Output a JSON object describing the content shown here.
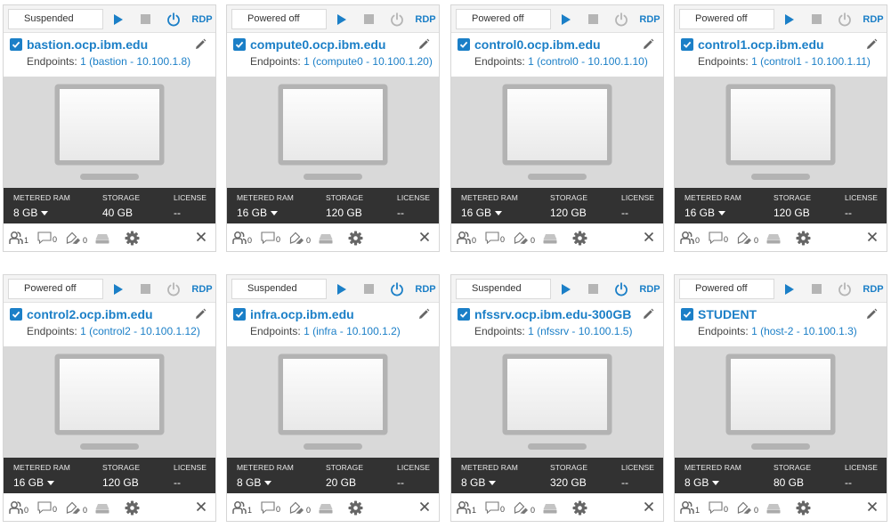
{
  "labels": {
    "rdp": "RDP",
    "endpoints_prefix": "Endpoints:",
    "metered_ram": "METERED RAM",
    "storage": "STORAGE",
    "license": "LICENSE"
  },
  "colors": {
    "accent": "#1b7fc7",
    "stats_bg": "#323232",
    "preview_bg": "#d9d9d9"
  },
  "icons": [
    "play-icon",
    "stop-icon",
    "power-icon",
    "checkbox-icon",
    "pencil-icon",
    "monitor-icon",
    "users-icon",
    "comment-icon",
    "tag-icon",
    "disk-icon",
    "gear-icon",
    "close-icon"
  ],
  "vms": [
    {
      "status": "Suspended",
      "power_on": true,
      "name": "bastion.ocp.ibm.edu",
      "endpoint": "1 (bastion - 10.100.1.8)",
      "ram": "8 GB",
      "storage": "40 GB",
      "license": "--",
      "users": "1",
      "comments": "0",
      "tags": "0"
    },
    {
      "status": "Powered off",
      "power_on": false,
      "name": "compute0.ocp.ibm.edu",
      "endpoint": "1 (compute0 - 10.100.1.20)",
      "ram": "16 GB",
      "storage": "120 GB",
      "license": "--",
      "users": "0",
      "comments": "0",
      "tags": "0"
    },
    {
      "status": "Powered off",
      "power_on": false,
      "name": "control0.ocp.ibm.edu",
      "endpoint": "1 (control0 - 10.100.1.10)",
      "ram": "16 GB",
      "storage": "120 GB",
      "license": "--",
      "users": "0",
      "comments": "0",
      "tags": "0"
    },
    {
      "status": "Powered off",
      "power_on": false,
      "name": "control1.ocp.ibm.edu",
      "endpoint": "1 (control1 - 10.100.1.11)",
      "ram": "16 GB",
      "storage": "120 GB",
      "license": "--",
      "users": "0",
      "comments": "0",
      "tags": "0"
    },
    {
      "status": "Powered off",
      "power_on": false,
      "name": "control2.ocp.ibm.edu",
      "endpoint": "1 (control2 - 10.100.1.12)",
      "ram": "16 GB",
      "storage": "120 GB",
      "license": "--",
      "users": "0",
      "comments": "0",
      "tags": "0"
    },
    {
      "status": "Suspended",
      "power_on": true,
      "name": "infra.ocp.ibm.edu",
      "endpoint": "1 (infra - 10.100.1.2)",
      "ram": "8 GB",
      "storage": "20 GB",
      "license": "--",
      "users": "1",
      "comments": "0",
      "tags": "0"
    },
    {
      "status": "Suspended",
      "power_on": true,
      "name": "nfssrv.ocp.ibm.edu-300GB",
      "endpoint": "1 (nfssrv - 10.100.1.5)",
      "ram": "8 GB",
      "storage": "320 GB",
      "license": "--",
      "users": "1",
      "comments": "0",
      "tags": "0"
    },
    {
      "status": "Powered off",
      "power_on": false,
      "name": "STUDENT",
      "endpoint": "1 (host-2 - 10.100.1.3)",
      "ram": "8 GB",
      "storage": "80 GB",
      "license": "--",
      "users": "1",
      "comments": "0",
      "tags": "0"
    }
  ]
}
